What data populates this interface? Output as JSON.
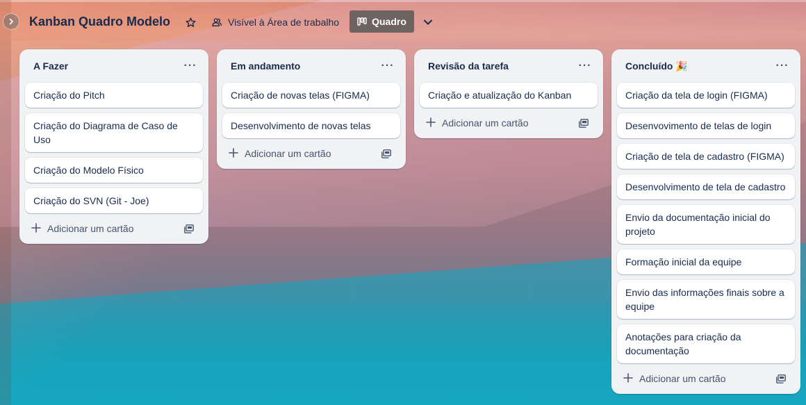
{
  "board": {
    "title": "Kanban Quadro Modelo",
    "visibility_label": "Visível à Área de trabalho",
    "view_label": "Quadro"
  },
  "icons": {
    "sidebar_toggle": "chevron-right-icon",
    "star": "star-icon",
    "visibility": "people-icon",
    "view": "board-icon",
    "dropdown": "chevron-down-icon",
    "list_menu": "more-horizontal-icon",
    "add": "plus-icon",
    "template": "card-template-icon"
  },
  "colors": {
    "view_button": "#6f6361",
    "list_bg": "#f1f2f4",
    "card_bg": "#ffffff",
    "text": "#172b4d"
  },
  "lists": [
    {
      "title": "A Fazer",
      "menu_label": "···",
      "cards": [
        "Criação do Pitch",
        "Criação do Diagrama de Caso de Uso",
        "Criação do Modelo Físico",
        "Criação do SVN (Git - Joe)"
      ],
      "add_label": "Adicionar um cartão"
    },
    {
      "title": "Em andamento",
      "menu_label": "···",
      "cards": [
        "Criação de novas telas (FIGMA)",
        "Desenvolvimento de novas telas"
      ],
      "add_label": "Adicionar um cartão"
    },
    {
      "title": "Revisão da tarefa",
      "menu_label": "···",
      "cards": [
        "Criação e atualização do Kanban"
      ],
      "add_label": "Adicionar um cartão"
    },
    {
      "title": "Concluído 🎉",
      "menu_label": "···",
      "cards": [
        "Criação da tela de login (FIGMA)",
        "Desenvovimento de telas de login",
        "Criação de tela de cadastro (FIGMA)",
        "Desenvolvimento de tela de cadastro",
        "Envio da documentação inicial do projeto",
        "Formação inicial da equipe",
        "Envio das informações finais sobre a equipe",
        "Anotações para criação da documentação"
      ],
      "add_label": "Adicionar um cartão"
    }
  ]
}
